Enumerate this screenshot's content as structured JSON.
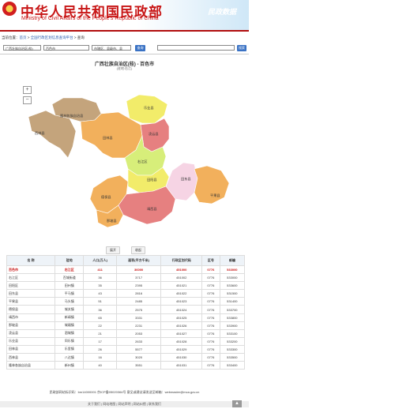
{
  "header": {
    "title_cn": "中华人民共和国民政部",
    "title_en": "Ministry of Civil Affairs of the People's Republic of China",
    "right_slogan": "民政数据"
  },
  "breadcrumb": {
    "prefix": "当前位置：",
    "home": "首页",
    "sep1": " > ",
    "platform": "全国行政区划信息查询平台",
    "sep2": " > ",
    "current": "查询"
  },
  "filters": {
    "province": "广西壮族自治区(桂)",
    "city": "百色市",
    "county": "市辖区、县级市、县",
    "query_button": "查询",
    "search_placeholder": "",
    "search_button": "搜索"
  },
  "map": {
    "title": "广西壮族自治区(桂) - 百色市",
    "subtitle": "(驻地:右江)",
    "zoom_in": "+",
    "zoom_out": "−",
    "regions": [
      {
        "name": "乐业县",
        "color": "#f2ec6a"
      },
      {
        "name": "隆林各族自治县",
        "color": "#c4a47c"
      },
      {
        "name": "西林县",
        "color": "#c4a47c"
      },
      {
        "name": "田林县",
        "color": "#f2b05c"
      },
      {
        "name": "凌云县",
        "color": "#e68080"
      },
      {
        "name": "右江区",
        "color": "#d7ee7a"
      },
      {
        "name": "德保县",
        "color": "#f2b05c"
      },
      {
        "name": "田阳县",
        "color": "#f2ec6a"
      },
      {
        "name": "田东县",
        "color": "#f6d4e4"
      },
      {
        "name": "平果县",
        "color": "#f2b05c"
      },
      {
        "name": "那坡县",
        "color": "#f2b05c"
      },
      {
        "name": "靖西县",
        "color": "#e68080"
      }
    ],
    "buttons": {
      "expand": "展开",
      "collapse": "收起"
    }
  },
  "table": {
    "headers": [
      "名 称",
      "驻地",
      "人口(万人)",
      "面积(平方千米)",
      "行政区划代码",
      "区号",
      "邮编"
    ],
    "rows": [
      [
        "百色市",
        "右江区",
        "411",
        "36000",
        "451000",
        "0776",
        "533000"
      ],
      [
        "右江区",
        "百城街道",
        "36",
        "3717",
        "451002",
        "0776",
        "533000"
      ],
      [
        "田阳区",
        "田州镇",
        "35",
        "2395",
        "451021",
        "0776",
        "533600"
      ],
      [
        "田东县",
        "平马镇",
        "43",
        "2816",
        "451022",
        "0776",
        "531500"
      ],
      [
        "平果县",
        "马头镇",
        "51",
        "2485",
        "451023",
        "0776",
        "531400"
      ],
      [
        "德保县",
        "城关镇",
        "36",
        "2575",
        "451024",
        "0776",
        "533700"
      ],
      [
        "靖西市",
        "新靖镇",
        "65",
        "3331",
        "451025",
        "0776",
        "533800"
      ],
      [
        "那坡县",
        "城厢镇",
        "22",
        "2231",
        "451026",
        "0776",
        "533900"
      ],
      [
        "凌云县",
        "泗城镇",
        "21",
        "2053",
        "451027",
        "0776",
        "533100"
      ],
      [
        "乐业县",
        "同乐镇",
        "17",
        "2633",
        "451028",
        "0776",
        "533200"
      ],
      [
        "田林县",
        "乐里镇",
        "26",
        "5577",
        "451029",
        "0776",
        "533300"
      ],
      [
        "西林县",
        "八达镇",
        "16",
        "3020",
        "451030",
        "0776",
        "533500"
      ],
      [
        "隆林各族自治县",
        "新州镇",
        "40",
        "3551",
        "451031",
        "0776",
        "533400"
      ]
    ]
  },
  "footer": {
    "line1_a": "民政部网站标识码：",
    "line1_code": "bm14000001",
    "line1_b": "  京ICP备05020364号  ",
    "line1_c": "  意见或建议请发送至邮箱：",
    "line1_email": "webmaster@mca.gov.cn",
    "links": [
      "关于我们",
      "网站地图",
      "网站声明",
      "网站纠错",
      "联系我们"
    ],
    "totop": "▲"
  }
}
